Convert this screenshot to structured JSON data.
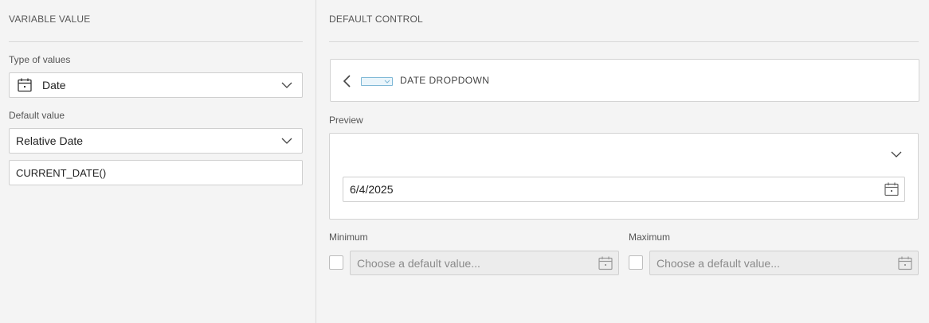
{
  "variable_value": {
    "title": "VARIABLE VALUE",
    "type_label": "Type of values",
    "type_value": "Date",
    "default_label": "Default value",
    "default_value": "Relative Date",
    "expression": "CURRENT_DATE()"
  },
  "default_control": {
    "title": "DEFAULT CONTROL",
    "control_name": "DATE DROPDOWN",
    "preview_label": "Preview",
    "preview_date": "6/4/2025",
    "minimum_label": "Minimum",
    "maximum_label": "Maximum",
    "minimum_placeholder": "Choose a default value...",
    "maximum_placeholder": "Choose a default value..."
  },
  "icons": {
    "calendar": "calendar-icon",
    "chevron": "chevron-down-icon",
    "back": "chevron-left-icon"
  },
  "colors": {
    "accent_border": "#7fb8d6",
    "accent_fill": "#eaf5fb",
    "background": "#f4f4f4"
  }
}
